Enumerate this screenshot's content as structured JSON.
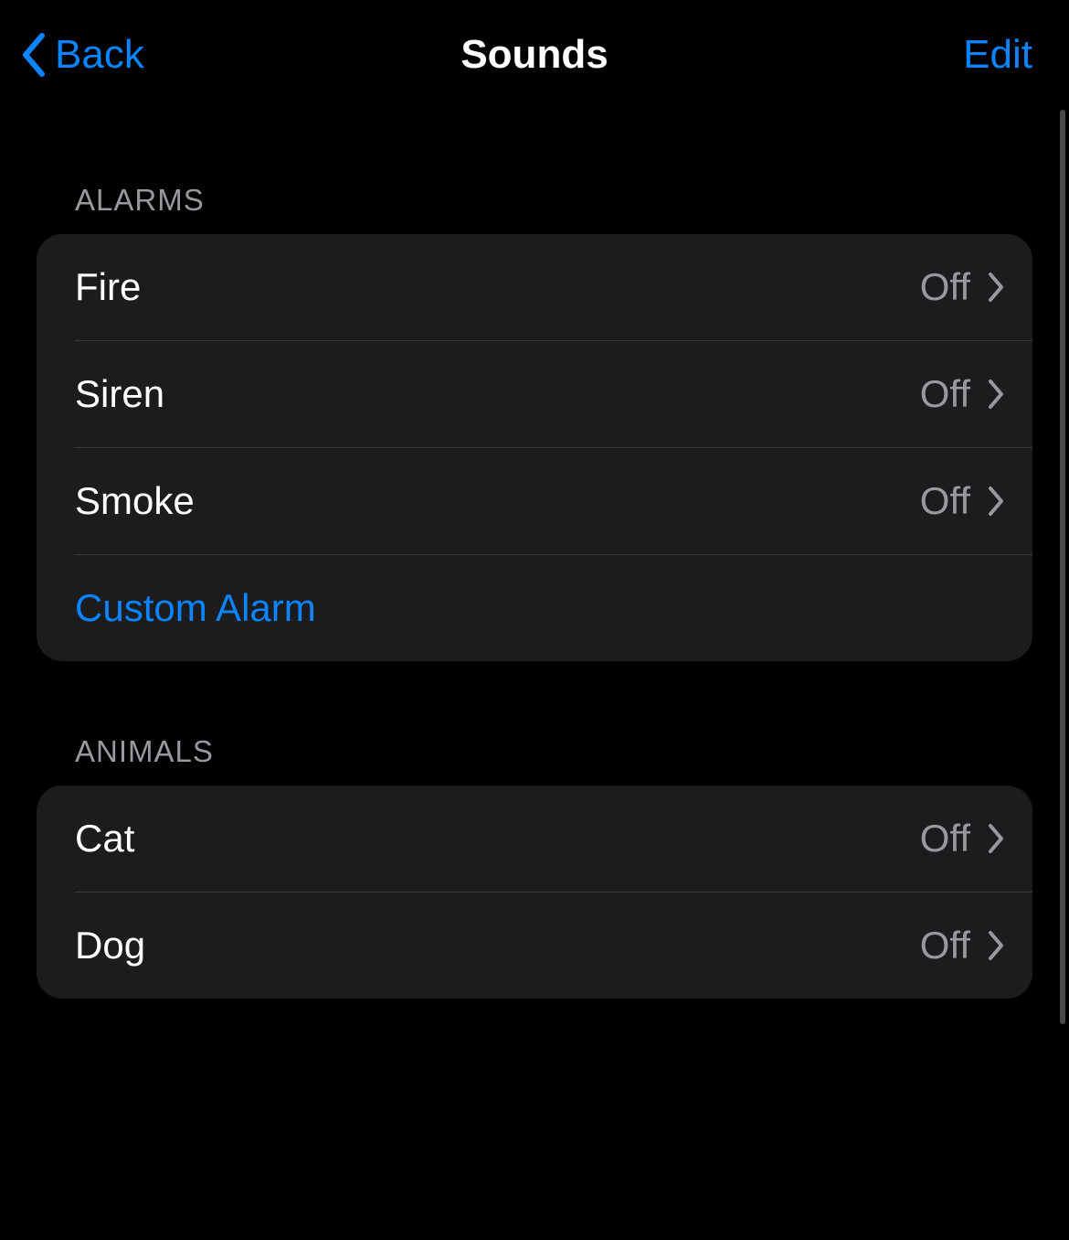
{
  "nav": {
    "back_label": "Back",
    "title": "Sounds",
    "edit_label": "Edit"
  },
  "sections": {
    "alarms": {
      "header": "ALARMS",
      "items": [
        {
          "label": "Fire",
          "value": "Off"
        },
        {
          "label": "Siren",
          "value": "Off"
        },
        {
          "label": "Smoke",
          "value": "Off"
        }
      ],
      "custom_label": "Custom Alarm"
    },
    "animals": {
      "header": "ANIMALS",
      "items": [
        {
          "label": "Cat",
          "value": "Off"
        },
        {
          "label": "Dog",
          "value": "Off"
        }
      ]
    }
  }
}
